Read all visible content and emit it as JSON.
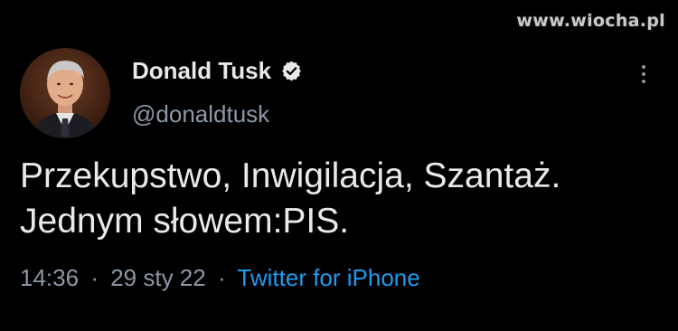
{
  "watermark": "www.wiocha.pl",
  "tweet": {
    "author": {
      "display_name": "Donald Tusk",
      "handle": "@donaldtusk",
      "verified": true,
      "verified_icon": "verified-badge-icon",
      "avatar": "avatar-photo"
    },
    "text_lines": [
      "Przekupstwo, Inwigilacja, Szantaż.",
      "Jednym słowem:PIS."
    ],
    "time": "14:36",
    "date": "29 sty 22",
    "separator": "·",
    "source": "Twitter for iPhone"
  },
  "icons": {
    "more": "more-vertical-icon"
  },
  "colors": {
    "background": "#000000",
    "text": "#e7e9ea",
    "secondary_text": "#8b98a5",
    "link": "#1d9bf0",
    "verified_badge": "#e7e9ea"
  }
}
